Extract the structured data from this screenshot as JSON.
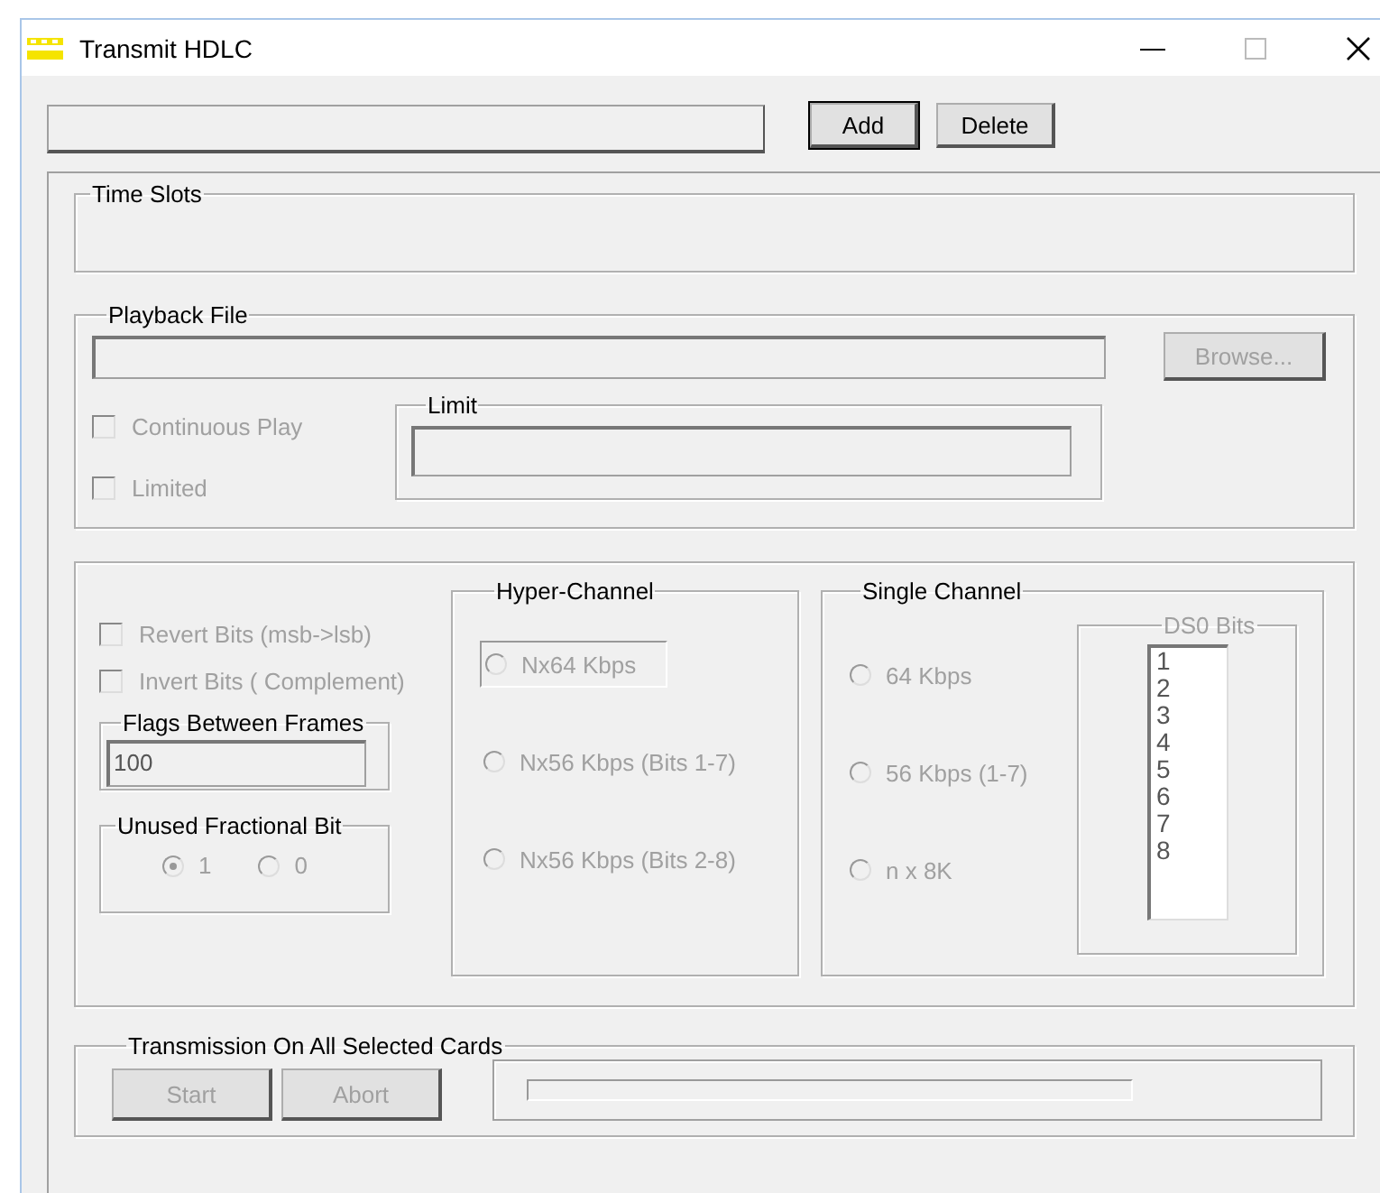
{
  "window": {
    "title": "Transmit HDLC"
  },
  "toolbar": {
    "buttons": [
      "Add",
      "Delete"
    ]
  },
  "time_slots": {
    "title": "Time Slots"
  },
  "playback": {
    "title": "Playback File",
    "browse": {
      "label": "Browse...",
      "disabled": true
    },
    "options": [
      {
        "label": "Continuous Play",
        "checked": false,
        "disabled": true
      },
      {
        "label": "Limited",
        "checked": false,
        "disabled": true
      }
    ],
    "limit": {
      "title": "Limit"
    }
  },
  "bits": {
    "checkboxes": [
      {
        "label": "Revert Bits (msb->lsb)",
        "checked": false,
        "disabled": true
      },
      {
        "label": "Invert Bits ( Complement)",
        "checked": false,
        "disabled": true
      }
    ],
    "flags": {
      "title": "Flags Between Frames",
      "value": "100"
    },
    "fractional": {
      "title": "Unused Fractional Bit",
      "options": [
        {
          "label": "1",
          "selected": true,
          "disabled": true
        },
        {
          "label": "0",
          "selected": false,
          "disabled": true
        }
      ]
    }
  },
  "hyper": {
    "title": "Hyper-Channel",
    "options": [
      {
        "label": "Nx64 Kbps",
        "selected": false,
        "disabled": true,
        "focused": true
      },
      {
        "label": "Nx56 Kbps (Bits 1-7)",
        "selected": false,
        "disabled": true,
        "focused": false
      },
      {
        "label": "Nx56 Kbps (Bits 2-8)",
        "selected": false,
        "disabled": true,
        "focused": false
      }
    ]
  },
  "single": {
    "title": "Single Channel",
    "options": [
      {
        "label": "64 Kbps",
        "selected": false,
        "disabled": true
      },
      {
        "label": "56 Kbps (1-7)",
        "selected": false,
        "disabled": true
      },
      {
        "label": "n x 8K",
        "selected": false,
        "disabled": true
      }
    ],
    "ds0": {
      "title": "DS0 Bits",
      "disabled": true,
      "items": [
        "1",
        "2",
        "3",
        "4",
        "5",
        "6",
        "7",
        "8"
      ]
    }
  },
  "transmission": {
    "title": "Transmission On All Selected Cards",
    "buttons": [
      {
        "label": "Start",
        "disabled": true
      },
      {
        "label": "Abort",
        "disabled": true
      }
    ]
  }
}
